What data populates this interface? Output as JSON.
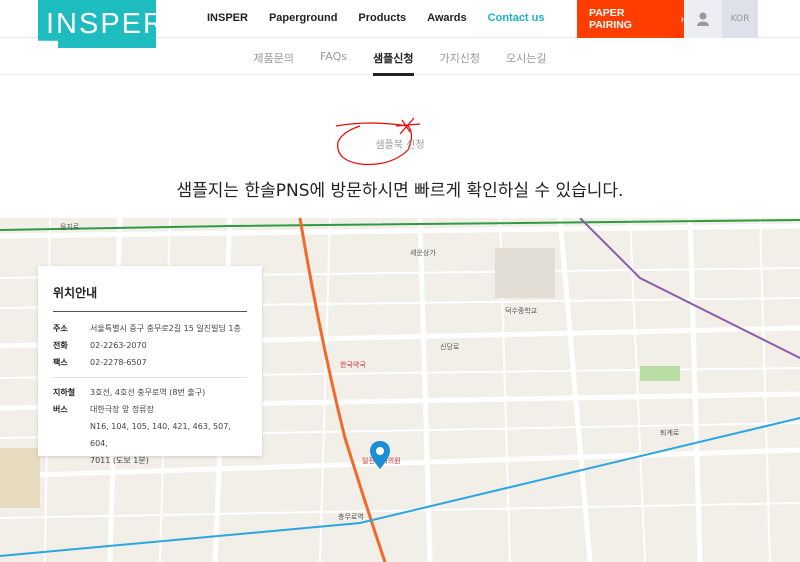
{
  "header": {
    "logo": "INSPER",
    "nav": [
      "INSPER",
      "Paperground",
      "Products",
      "Awards",
      "Contact us"
    ],
    "paper_pairing": "PAPER PAIRING",
    "lang": "KOR",
    "accent": "#1dbcbf",
    "cta_color": "#ff3d00"
  },
  "subnav": [
    "제품문의",
    "FAQs",
    "샘플신청",
    "가지신청",
    "오시는길"
  ],
  "section": {
    "eyebrow": "샘플북 신청",
    "headline": "샘플지는 한솔PNS에 방문하시면 빠르게 확인하실 수 있습니다."
  },
  "info": {
    "title": "위치안내",
    "rows": [
      {
        "label": "주소",
        "value": "서울특별시 중구 충무로2길 15 일진빌딩 1층"
      },
      {
        "label": "전화",
        "value": "02-2263-2070"
      },
      {
        "label": "팩스",
        "value": "02-2278-6507"
      }
    ],
    "transit": [
      {
        "label": "지하철",
        "value": "3호선, 4호선 충무로역 (8번 출구)"
      },
      {
        "label": "버스",
        "value": "대한극장 앞 정류장",
        "value2": "N16, 104, 105, 140, 421, 463, 507, 604,",
        "value3": "7011 (도보 1분)"
      }
    ]
  },
  "map": {
    "labels": [
      "을지로",
      "일진치과의원",
      "충무로역",
      "퇴계로",
      "덕수중학교",
      "한국약국",
      "세운상가",
      "신당로"
    ]
  }
}
